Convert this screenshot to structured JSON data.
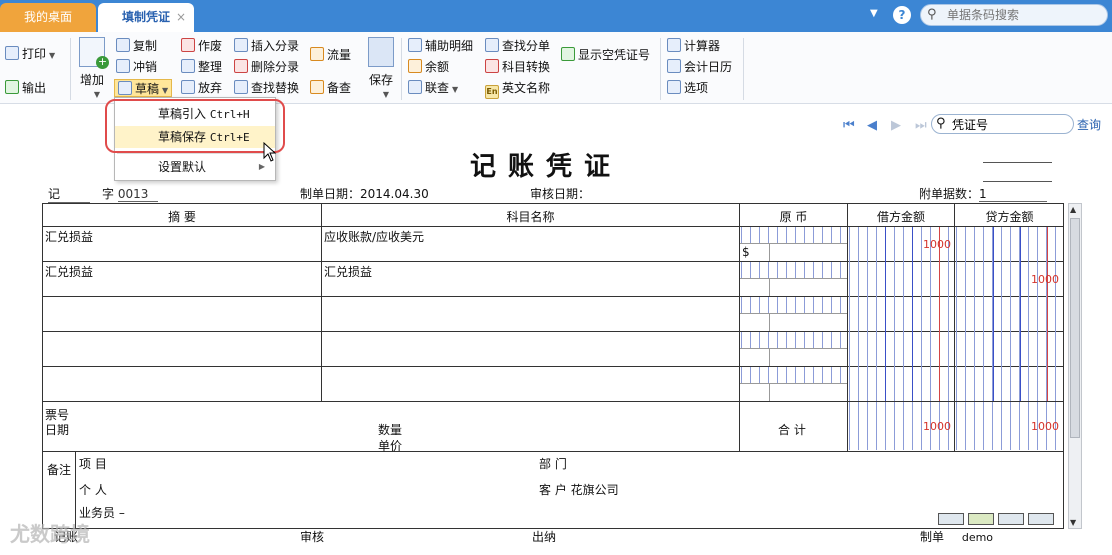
{
  "tabs": {
    "home": "我的桌面",
    "active": "填制凭证",
    "close": "×"
  },
  "titlebar": {
    "search_placeholder": "单据条码搜索"
  },
  "toolbar": {
    "print": "打印",
    "output": "输出",
    "add": "增加",
    "copy": "复制",
    "reverse": "冲销",
    "draft": "草稿",
    "void": "作废",
    "tidy": "整理",
    "discard": "放弃",
    "insert_entry": "插入分录",
    "delete_entry": "删除分录",
    "find_replace": "查找替换",
    "flow": "流量",
    "memo": "备查",
    "save": "保存",
    "aux_detail": "辅助明细",
    "balance": "余额",
    "link_query": "联查",
    "find_entry": "查找分单",
    "subject_convert": "科目转换",
    "english_name": "英文名称",
    "show_empty": "显示空凭证号",
    "calculator": "计算器",
    "accounting_calendar": "会计日历",
    "options": "选项"
  },
  "draft_menu": {
    "items": [
      {
        "label": "草稿引入",
        "shortcut": "Ctrl+H"
      },
      {
        "label": "草稿保存",
        "shortcut": "Ctrl+E"
      },
      {
        "label": "设置默认",
        "shortcut": ""
      }
    ]
  },
  "nav": {
    "search_value": "凭证号",
    "query": "查询"
  },
  "voucher": {
    "title": "记账凭证",
    "type": "记",
    "zi": "字",
    "number": "0013",
    "date_label": "制单日期：",
    "date": "2014.04.30",
    "audit_date_label": "审核日期：",
    "attach_label": "附单据数：",
    "attach_count": "1",
    "columns": {
      "summary": "摘 要",
      "subject": "科目名称",
      "original_currency": "原 币",
      "debit": "借方金额",
      "credit": "贷方金额"
    },
    "rows": [
      {
        "summary": "汇兑损益",
        "subject": "应收账款/应收美元",
        "currency": "$",
        "debit": "1000",
        "credit": ""
      },
      {
        "summary": "汇兑损益",
        "subject": "汇兑损益",
        "currency": "",
        "debit": "",
        "credit": "1000"
      }
    ],
    "bill_no": "票号",
    "bill_date": "日期",
    "quantity": "数量",
    "unit_price": "单价",
    "total_label": "合 计",
    "total_debit": "1000",
    "total_credit": "1000",
    "remark": "备注",
    "project": "项  目",
    "department": "部  门",
    "individual": "个  人",
    "customer": "客  户",
    "customer_value": "花旗公司",
    "salesman": "业务员",
    "salesman_value": "–"
  },
  "footer": {
    "bookkeeping": "记账",
    "audit": "审核",
    "cashier": "出纳",
    "maker": "制单",
    "maker_value": "demo"
  },
  "watermark": "尤数跨境"
}
